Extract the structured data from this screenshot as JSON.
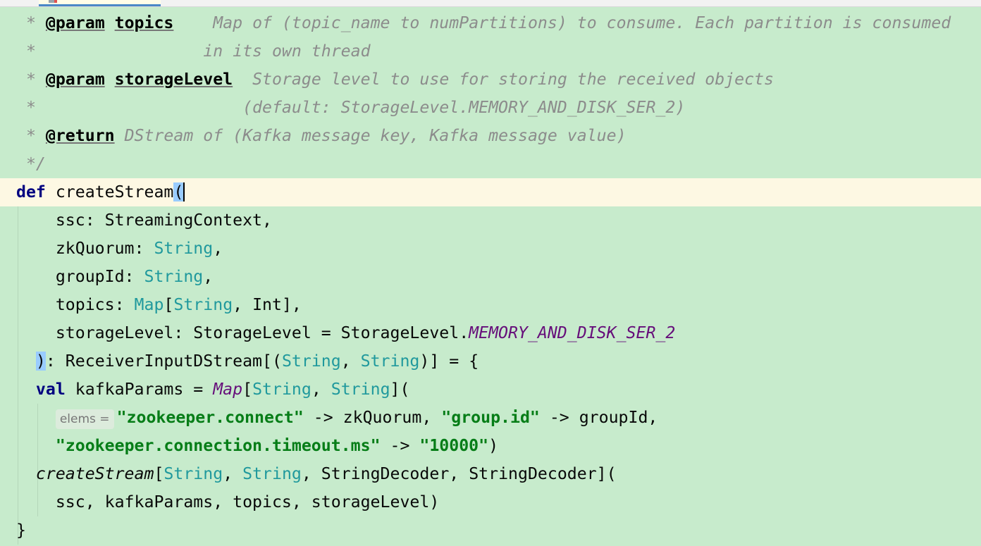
{
  "colors": {
    "background": "#c7ebcc",
    "current_line": "#fdf8e3",
    "keyword": "#000080",
    "type": "#20999d",
    "string": "#067d17",
    "constant": "#660e7a",
    "comment": "#8c8c8c",
    "bracket_match": "#99ccff"
  },
  "tab": {
    "active_indicator": "#4a88c7"
  },
  "lines": [
    {
      "tokens": [
        [
          " * ",
          "cm"
        ],
        [
          "@param",
          "tag"
        ],
        [
          " ",
          "cm"
        ],
        [
          "topics",
          "tag"
        ],
        [
          "    Map of (topic_name to numPartitions) to consume. Each partition is consumed",
          "cm"
        ]
      ]
    },
    {
      "tokens": [
        [
          " *                 in its own thread",
          "cm"
        ]
      ]
    },
    {
      "tokens": [
        [
          " * ",
          "cm"
        ],
        [
          "@param",
          "tag"
        ],
        [
          " ",
          "cm"
        ],
        [
          "storageLevel",
          "tag"
        ],
        [
          "  Storage level to use for storing the received objects",
          "cm"
        ]
      ]
    },
    {
      "tokens": [
        [
          " *                     (default: StorageLevel.MEMORY_AND_DISK_SER_2)",
          "cm"
        ]
      ]
    },
    {
      "tokens": [
        [
          " * ",
          "cm"
        ],
        [
          "@return",
          "tag"
        ],
        [
          " DStream of (Kafka message key, Kafka message value)",
          "cm"
        ]
      ]
    },
    {
      "tokens": [
        [
          " */",
          "cm"
        ]
      ]
    },
    {
      "current": true,
      "tokens": [
        [
          "def",
          "kw"
        ],
        [
          " createStream",
          ""
        ],
        [
          "(",
          "br caret"
        ]
      ]
    },
    {
      "tokens": [
        [
          "    ssc: StreamingContext,",
          ""
        ]
      ]
    },
    {
      "tokens": [
        [
          "    zkQuorum: ",
          ""
        ],
        [
          "String",
          "ty"
        ],
        [
          ",",
          ""
        ]
      ]
    },
    {
      "tokens": [
        [
          "    groupId: ",
          ""
        ],
        [
          "String",
          "ty"
        ],
        [
          ",",
          ""
        ]
      ]
    },
    {
      "tokens": [
        [
          "    topics: ",
          ""
        ],
        [
          "Map",
          "ty"
        ],
        [
          "[",
          ""
        ],
        [
          "String",
          "ty"
        ],
        [
          ", Int],",
          ""
        ]
      ]
    },
    {
      "tokens": [
        [
          "    storageLevel: StorageLevel = StorageLevel.",
          ""
        ],
        [
          "MEMORY_AND_DISK_SER_2",
          "it"
        ]
      ]
    },
    {
      "tokens": [
        [
          "  ",
          ""
        ],
        [
          ")",
          "br"
        ],
        [
          ": ReceiverInputDStream[(",
          ""
        ],
        [
          "String",
          "ty"
        ],
        [
          ", ",
          ""
        ],
        [
          "String",
          "ty"
        ],
        [
          ")] = {",
          ""
        ]
      ]
    },
    {
      "tokens": [
        [
          "  ",
          ""
        ],
        [
          "val",
          "kw"
        ],
        [
          " kafkaParams = ",
          ""
        ],
        [
          "Map",
          "it"
        ],
        [
          "[",
          ""
        ],
        [
          "String",
          "ty"
        ],
        [
          ", ",
          ""
        ],
        [
          "String",
          "ty"
        ],
        [
          "](",
          ""
        ]
      ]
    },
    {
      "tokens": [
        [
          "    ",
          ""
        ],
        [
          "elems =",
          "hint"
        ],
        [
          "\"zookeeper.connect\"",
          "str"
        ],
        [
          " -> zkQuorum, ",
          ""
        ],
        [
          "\"group.id\"",
          "str"
        ],
        [
          " -> groupId,",
          ""
        ]
      ]
    },
    {
      "tokens": [
        [
          "    ",
          ""
        ],
        [
          "\"zookeeper.connection.timeout.ms\"",
          "str"
        ],
        [
          " -> ",
          ""
        ],
        [
          "\"10000\"",
          "str"
        ],
        [
          ")",
          ""
        ]
      ]
    },
    {
      "tokens": [
        [
          "  ",
          ""
        ],
        [
          "createStream",
          "fn"
        ],
        [
          "[",
          ""
        ],
        [
          "String",
          "ty"
        ],
        [
          ", ",
          ""
        ],
        [
          "String",
          "ty"
        ],
        [
          ", StringDecoder, StringDecoder](",
          ""
        ]
      ]
    },
    {
      "tokens": [
        [
          "    ssc, kafkaParams, topics, storageLevel)",
          ""
        ]
      ]
    },
    {
      "tokens": [
        [
          "}",
          ""
        ]
      ]
    }
  ]
}
